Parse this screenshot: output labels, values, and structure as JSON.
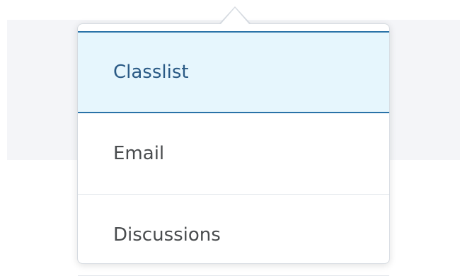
{
  "menu": {
    "items": [
      {
        "label": "Classlist",
        "selected": true
      },
      {
        "label": "Email",
        "selected": false
      },
      {
        "label": "Discussions",
        "selected": false
      }
    ]
  },
  "colors": {
    "selected_bg": "#e6f6fd",
    "selected_border": "#2a73a8",
    "selected_text": "#2a5a85",
    "text": "#494c4e"
  }
}
